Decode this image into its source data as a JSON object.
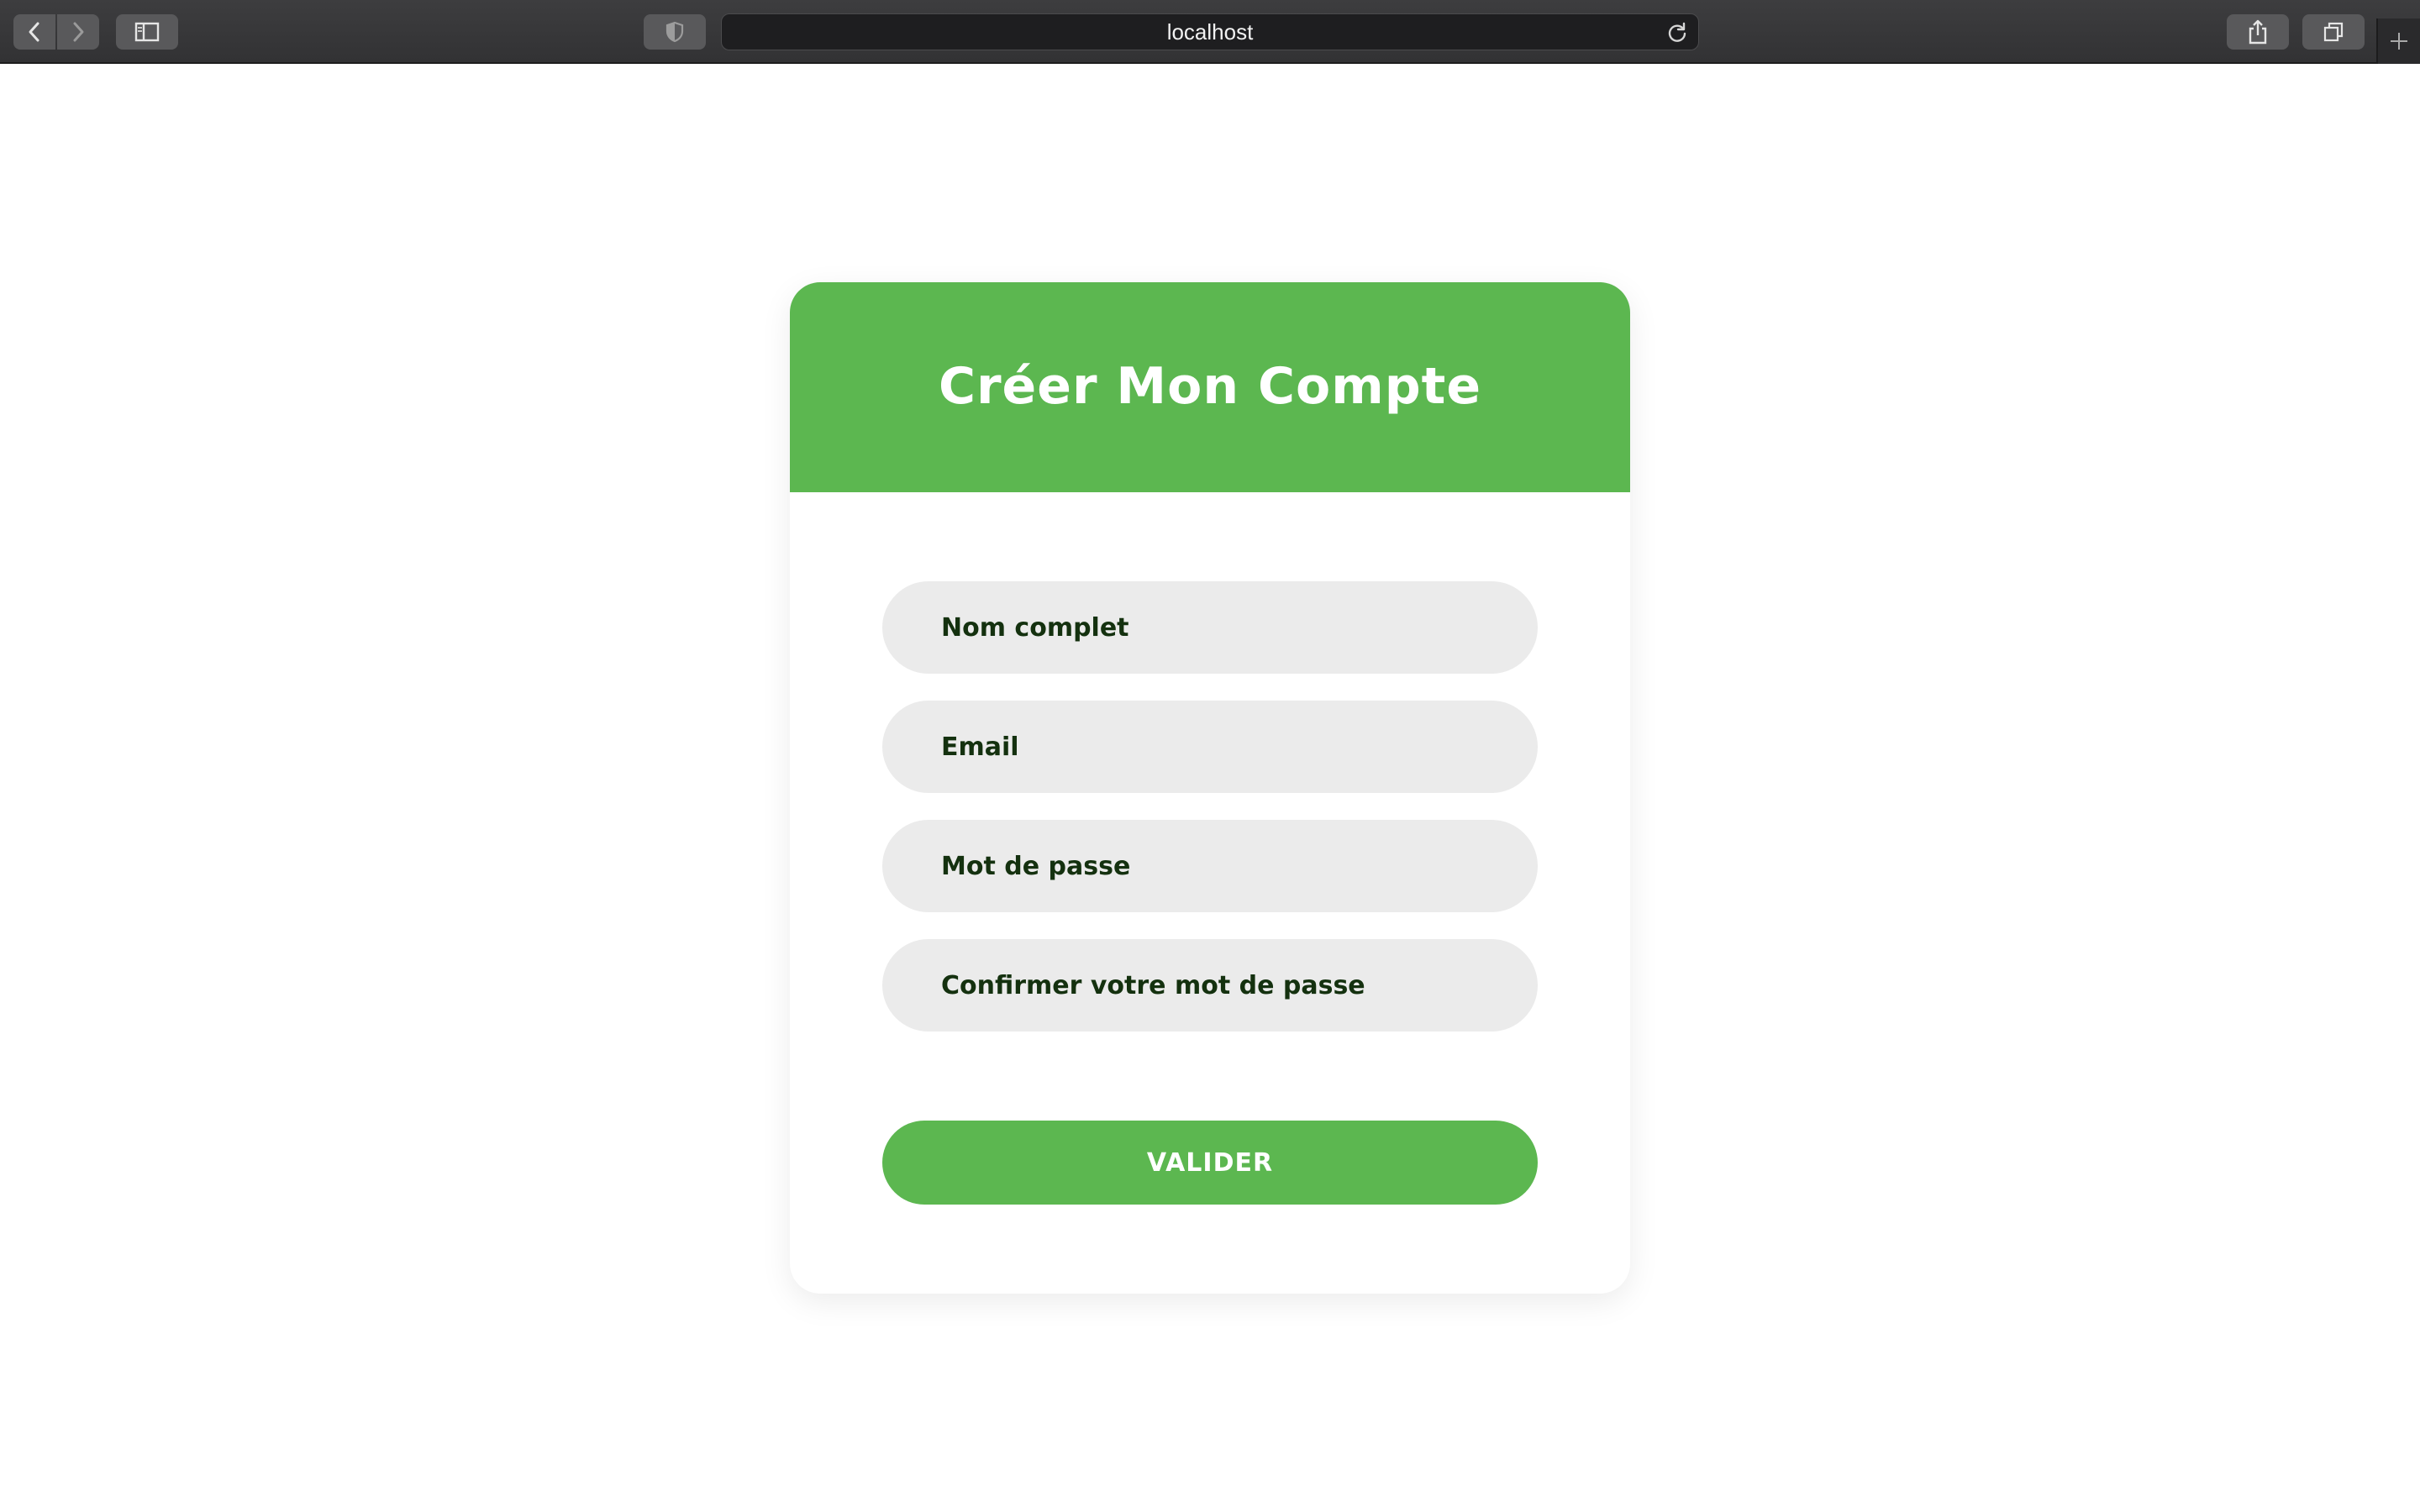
{
  "browser": {
    "url": "localhost",
    "icons": {
      "back": "chevron-left-icon",
      "forward": "chevron-right-icon",
      "sidebar": "sidebar-icon",
      "privacy": "shield-icon",
      "reload": "reload-icon",
      "share": "share-icon",
      "tabs": "tabs-overview-icon",
      "new_tab": "plus-icon"
    }
  },
  "form": {
    "title": "Créer Mon Compte",
    "fields": [
      {
        "placeholder": "Nom complet",
        "value": ""
      },
      {
        "placeholder": "Email",
        "value": ""
      },
      {
        "placeholder": "Mot de passe",
        "value": ""
      },
      {
        "placeholder": "Confirmer votre mot de passe",
        "value": ""
      }
    ],
    "submit_label": "VALIDER"
  },
  "colors": {
    "accent": "#5cb750",
    "field_bg": "#ebebeb",
    "field_text": "#14310f"
  }
}
